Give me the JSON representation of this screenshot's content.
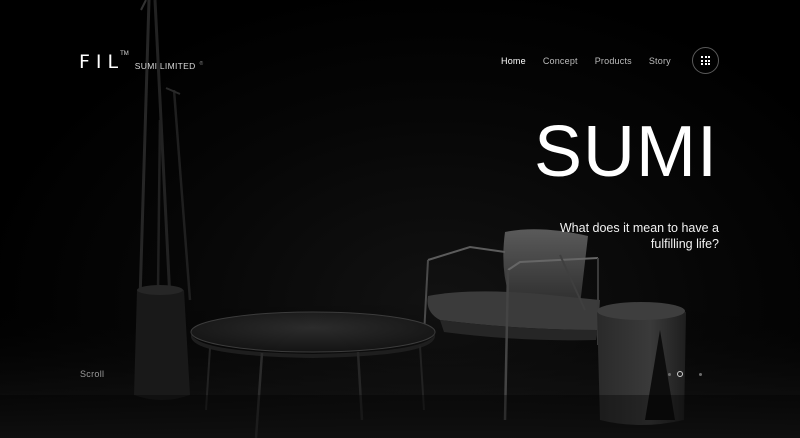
{
  "brand": {
    "mark": "FIL",
    "tm": "TM",
    "sub": "SUMI LIMITED",
    "dot": "®"
  },
  "nav": {
    "items": [
      {
        "label": "Home",
        "active": true
      },
      {
        "label": "Concept",
        "active": false
      },
      {
        "label": "Products",
        "active": false
      },
      {
        "label": "Story",
        "active": false
      }
    ],
    "menu_icon": "grid-icon"
  },
  "hero": {
    "title": "SUMI",
    "subtitle": "What does it mean to have a fulfilling life?"
  },
  "footer": {
    "scroll_label": "Scroll"
  },
  "pager": {
    "count": 3,
    "active_index": 1
  },
  "colors": {
    "background": "#000000",
    "text": "#ffffff",
    "muted": "#9a9a9a"
  }
}
